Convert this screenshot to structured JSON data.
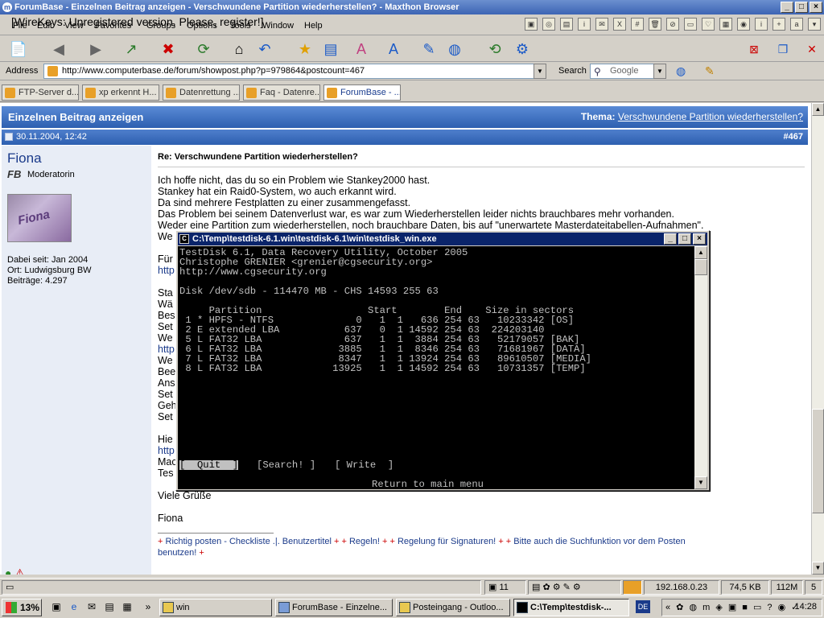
{
  "browser": {
    "title": "ForumBase - Einzelnen Beitrag anzeigen - Verschwundene Partition wiederherstellen? - Maxthon Browser",
    "wirekeys": "[WireKeys: Unregistered version. Please, register!]",
    "menus": [
      "File",
      "Edit",
      "View",
      "Favorites",
      "Groups",
      "Options",
      "Tools",
      "Window",
      "Help"
    ],
    "address_label": "Address",
    "url": "http://www.computerbase.de/forum/showpost.php?p=979864&postcount=467",
    "search_label": "Search",
    "search_engine": "Google"
  },
  "tabs": [
    {
      "label": "FTP-Server d..."
    },
    {
      "label": "xp erkennt H..."
    },
    {
      "label": "Datenrettung ..."
    },
    {
      "label": "Faq - Datenre..."
    },
    {
      "label": "ForumBase - ..."
    }
  ],
  "forum": {
    "header_title": "Einzelnen Beitrag anzeigen",
    "thema_label": "Thema:",
    "thema_link": "Verschwundene Partition wiederherstellen?",
    "post_date": "30.11.2004, 12:42",
    "post_number": "#467",
    "username": "Fiona",
    "user_role": "Moderatorin",
    "avatar_text": "Fiona",
    "user_since": "Dabei seit: Jan 2004",
    "user_location": "Ort: Ludwigsburg BW",
    "user_posts": "Beiträge: 4.297",
    "post_title": "Re: Verschwundene Partition wiederherstellen?",
    "body_lines": [
      "Ich hoffe nicht, das du so ein Problem wie Stankey2000 hast.",
      "Stankey hat ein Raid0-System, wo auch erkannt wird.",
      "Da sind mehrere Festplatten zu einer zusammengefasst.",
      "Das Problem bei seinem Datenverlust war, es war zum Wiederherstellen leider nichts brauchbares mehr vorhanden.",
      "Weder eine Partition zum wiederherstellen, noch brauchbare Daten, bis auf \"unerwartete Masterdateitabellen-Aufnahmen\".",
      "We"
    ],
    "body_fragments": [
      "Für",
      "http",
      "Sta",
      "Wä",
      "Bes",
      "Set",
      "We",
      "http",
      "We",
      "Bee",
      "Ans",
      "Set",
      "Geh",
      "Set",
      "Hie",
      "http",
      "Mac",
      "Tes"
    ],
    "greeting": "Viele Grüße",
    "signoff": "Fiona",
    "signature": {
      "line1": [
        "Richtig posten - Checkliste .|. Benutzertitel",
        "Regeln!",
        "Regelung für Signaturen!",
        "Bitte auch die Suchfunktion vor dem Posten"
      ],
      "line2": "benutzen!"
    }
  },
  "terminal": {
    "title": "C:\\Temp\\testdisk-6.1.win\\testdisk-6.1\\win\\testdisk_win.exe",
    "lines": [
      "TestDisk 6.1, Data Recovery Utility, October 2005",
      "Christophe GRENIER <grenier@cgsecurity.org>",
      "http://www.cgsecurity.org",
      "",
      "Disk /dev/sdb - 114470 MB - CHS 14593 255 63",
      "",
      "     Partition                  Start        End    Size in sectors",
      " 1 * HPFS - NTFS              0   1  1   636 254 63   10233342 [OS]",
      " 2 E extended LBA           637   0  1 14592 254 63  224203140",
      " 5 L FAT32 LBA              637   1  1  3884 254 63   52179057 [BAK]",
      " 6 L FAT32 LBA             3885   1  1  8346 254 63   71681967 [DATA]",
      " 7 L FAT32 LBA             8347   1  1 13924 254 63   89610507 [MEDIA]",
      " 8 L FAT32 LBA            13925   1  1 14592 254 63   10731357 [TEMP]"
    ],
    "menu_quit": "[  Quit  ]",
    "menu_search": "[Search! ]",
    "menu_write": "[ Write  ]",
    "hint": "Return to main menu"
  },
  "statusbar": {
    "count": "11",
    "ip": "192.168.0.23",
    "size": "74,5 KB",
    "memory": "112M",
    "extra": "5"
  },
  "taskbar": {
    "start_label": "13%",
    "tasks": [
      {
        "label": "win"
      },
      {
        "label": "ForumBase - Einzelne..."
      },
      {
        "label": "Posteingang - Outloo..."
      },
      {
        "label": "C:\\Temp\\testdisk-..."
      }
    ],
    "lang": "DE",
    "clock": "14:28"
  }
}
